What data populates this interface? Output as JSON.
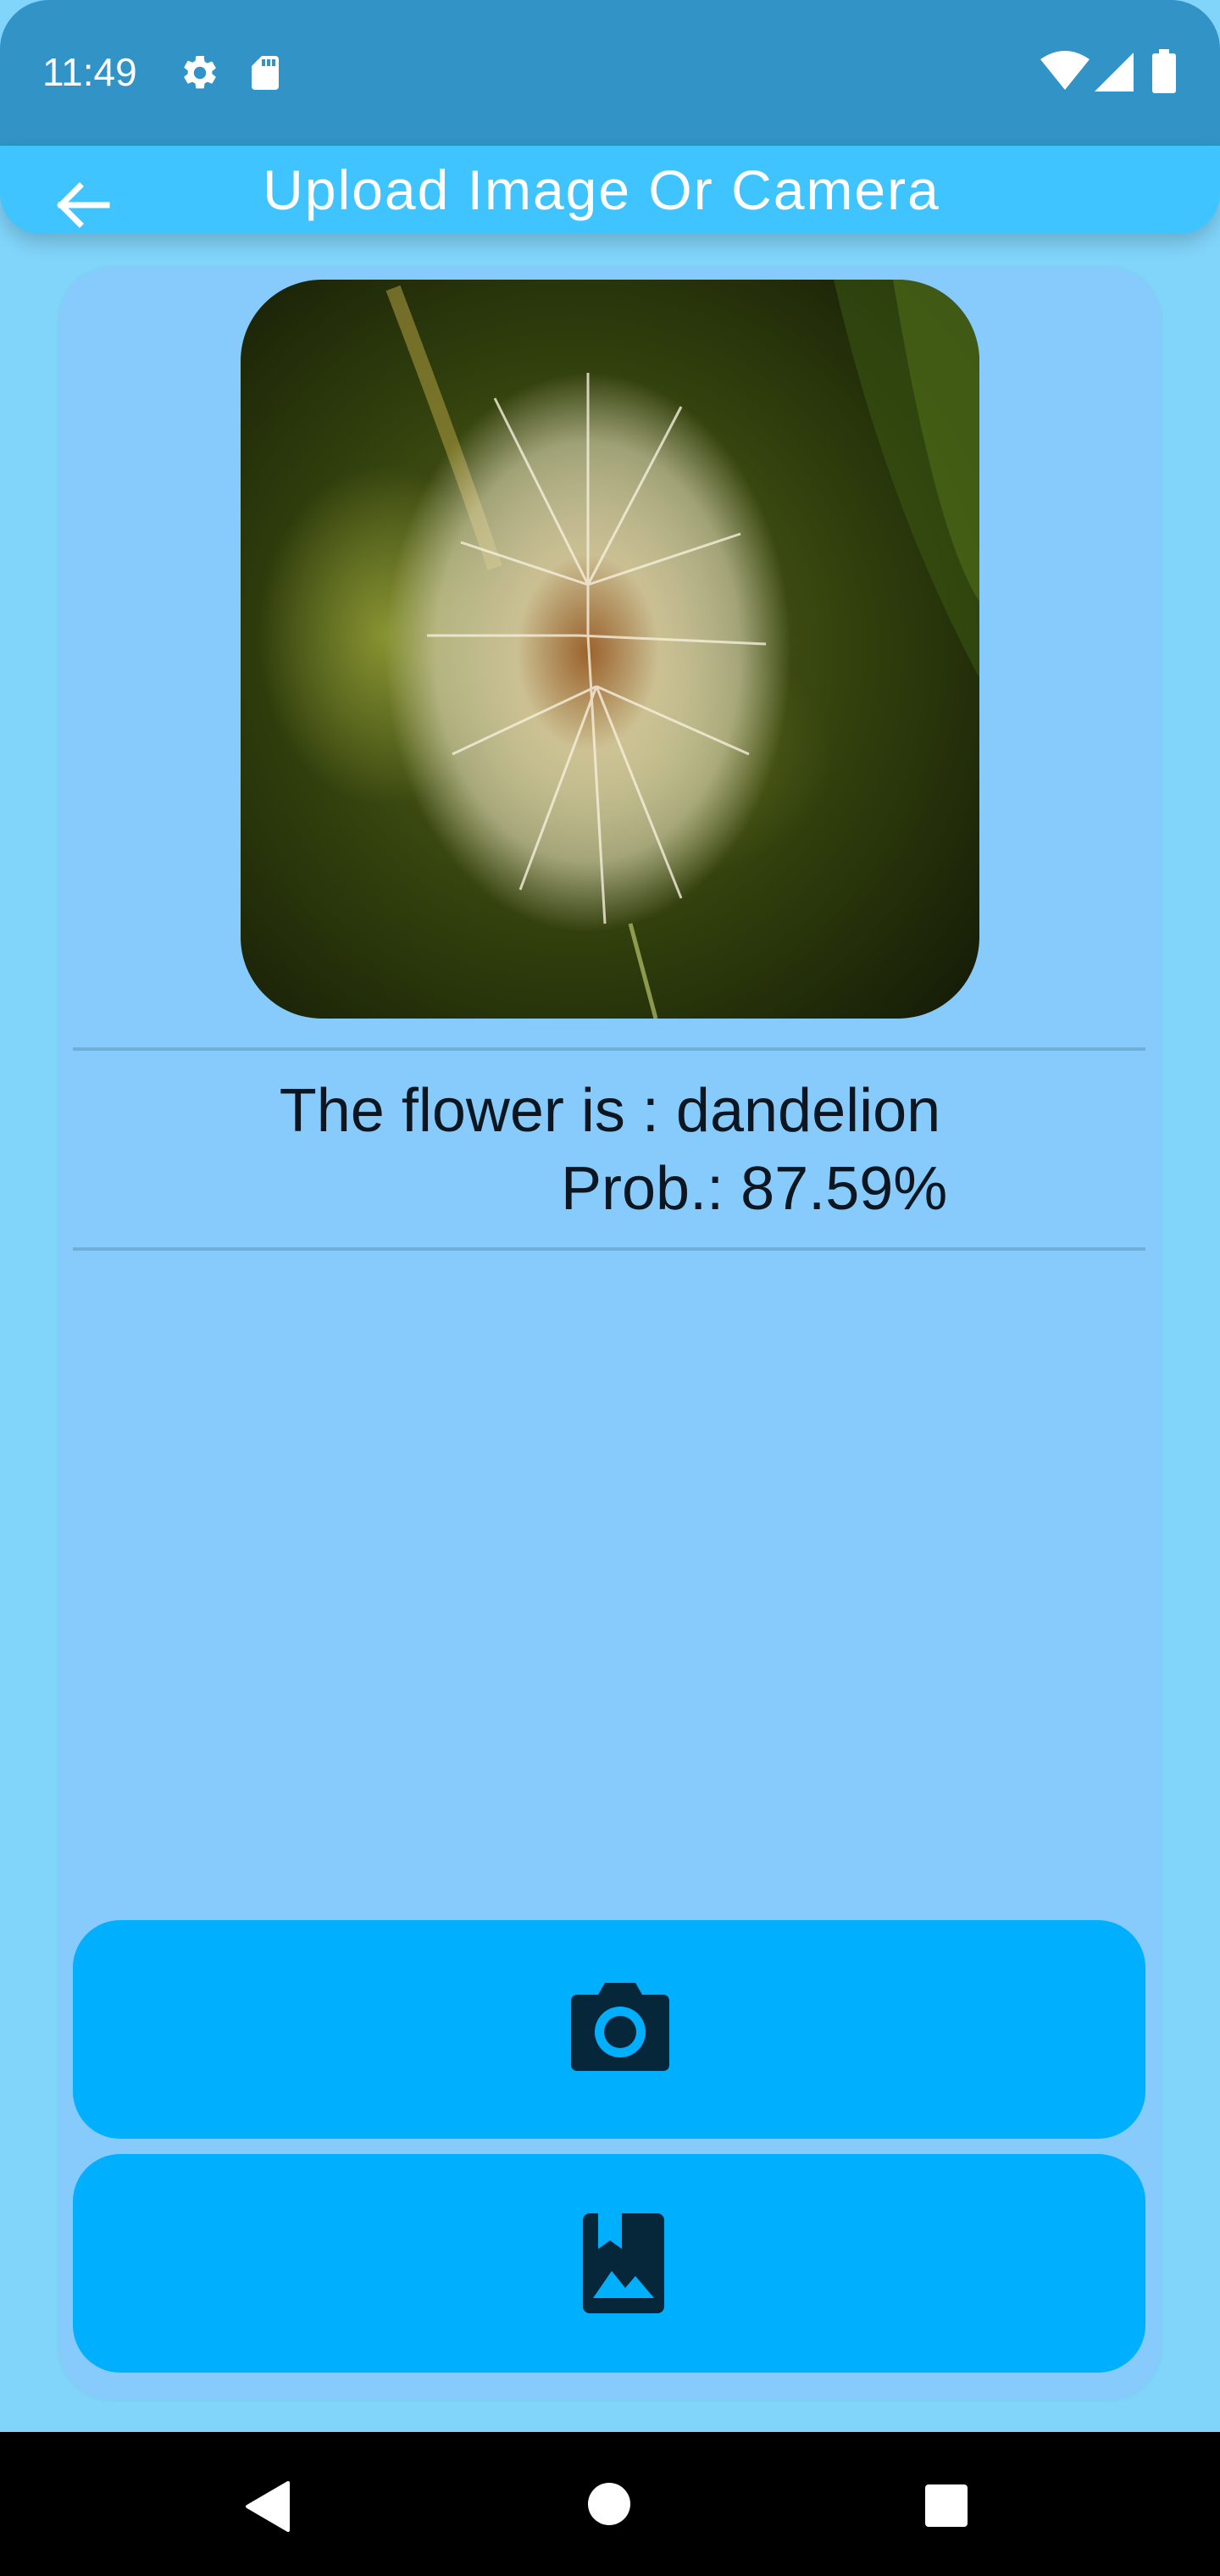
{
  "status_bar": {
    "time": "11:49",
    "icons": [
      "gear-icon",
      "sd-card-icon",
      "wifi-icon",
      "cell-signal-icon",
      "battery-icon"
    ]
  },
  "app_bar": {
    "title": "Upload Image Or Camera",
    "back_icon": "arrow-left-icon"
  },
  "result": {
    "line1": "The flower is : dandelion",
    "line2": "Prob.: 87.59%"
  },
  "buttons": {
    "camera_icon": "camera-icon",
    "gallery_icon": "photo-album-icon"
  },
  "nav_bar": {
    "icons": [
      "back-triangle-icon",
      "home-circle-icon",
      "recents-square-icon"
    ]
  },
  "colors": {
    "status_bar": "#3193c6",
    "app_bar": "#40c4ff",
    "background": "#81d4fa",
    "card": "#87cbfd",
    "button": "#00b0ff",
    "text": "#0c1620"
  }
}
